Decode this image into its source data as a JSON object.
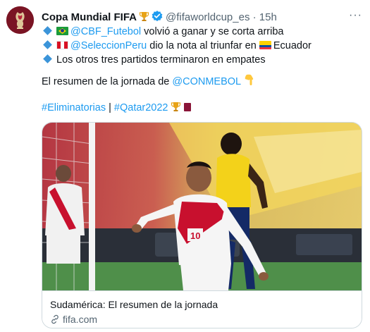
{
  "tweet": {
    "author_name": "Copa Mundial FIFA",
    "author_handle": "@fifaworldcup_es",
    "separator": "·",
    "time": "15h",
    "more_label": "···",
    "lines": [
      {
        "mention": "@CBF_Futebol",
        "text": " volvió a ganar y se corta arriba"
      },
      {
        "mention": "@SeleccionPeru",
        "text": " dio la nota al triunfar en ",
        "suffix": "Ecuador"
      },
      {
        "text": "Los otros tres partidos terminaron en empates"
      }
    ],
    "summary_text": "El resumen de la jornada de ",
    "summary_mention": "@CONMEBOL",
    "hashtag1": "#Eliminatorias",
    "pipe": " | ",
    "hashtag2": "#Qatar2022"
  },
  "card": {
    "title": "Sudamérica: El resumen de la jornada",
    "domain": "fifa.com"
  },
  "colors": {
    "link": "#1d9bf0",
    "secondary_text": "#536471",
    "avatar_bg": "#7a1424",
    "diamond": "#3b94d9"
  },
  "icons": [
    "fifa-logo-icon",
    "trophy-icon",
    "verified-badge-icon",
    "more-icon",
    "diamond-icon",
    "brazil-flag-icon",
    "peru-flag-icon",
    "ecuador-flag-icon",
    "pointing-down-icon",
    "qatar-flag-icon",
    "link-icon"
  ]
}
